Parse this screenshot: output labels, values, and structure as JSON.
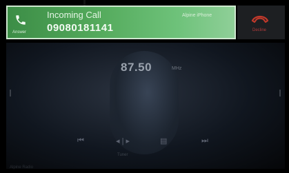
{
  "call": {
    "title": "Incoming Call",
    "number": "09080181141",
    "device": "Alpine iPhone",
    "phone_label": "Answer",
    "decline_label": "Decline"
  },
  "radio": {
    "frequency": "87.50",
    "unit": "MHz"
  },
  "controls": {
    "prev": "⏮",
    "mode": "◂ | ▸",
    "mode_label": "Tuner",
    "menu": "▤",
    "next": "⏭"
  },
  "footer": {
    "text": "Alpine Radio"
  },
  "icons": {
    "phone": "phone-icon",
    "decline": "decline-icon"
  },
  "colors": {
    "accent_green": "#54aa5c",
    "decline_red": "#c0392b"
  }
}
